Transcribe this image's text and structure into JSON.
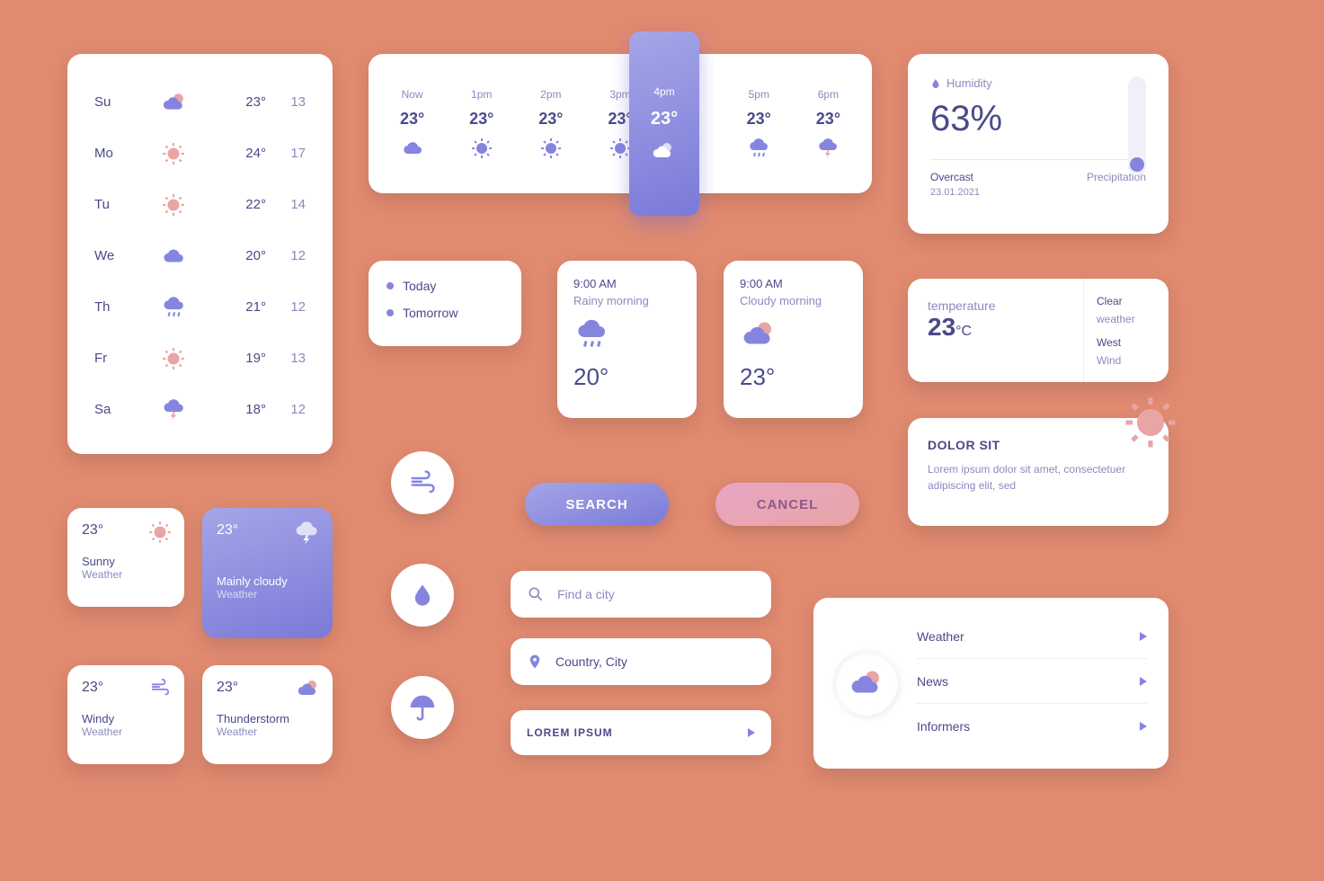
{
  "weekly": [
    {
      "day": "Su",
      "icon": "partly-cloudy",
      "hi": "23°",
      "lo": "13"
    },
    {
      "day": "Mo",
      "icon": "sun-pink",
      "hi": "24°",
      "lo": "17"
    },
    {
      "day": "Tu",
      "icon": "sun-pink",
      "hi": "22°",
      "lo": "14"
    },
    {
      "day": "We",
      "icon": "cloud",
      "hi": "20°",
      "lo": "12"
    },
    {
      "day": "Th",
      "icon": "rain",
      "hi": "21°",
      "lo": "12"
    },
    {
      "day": "Fr",
      "icon": "sun-pink",
      "hi": "19°",
      "lo": "13"
    },
    {
      "day": "Sa",
      "icon": "storm",
      "hi": "18°",
      "lo": "12"
    }
  ],
  "hourly": [
    {
      "time": "Now",
      "temp": "23°",
      "icon": "cloud"
    },
    {
      "time": "1pm",
      "temp": "23°",
      "icon": "sun"
    },
    {
      "time": "2pm",
      "temp": "23°",
      "icon": "sun"
    },
    {
      "time": "3pm",
      "temp": "23°",
      "icon": "sun"
    },
    {
      "time": "4pm",
      "temp": "23°",
      "icon": "partly-cloudy-white",
      "selected": true
    },
    {
      "time": "5pm",
      "temp": "23°",
      "icon": "rain"
    },
    {
      "time": "6pm",
      "temp": "23°",
      "icon": "storm"
    }
  ],
  "humidity": {
    "label": "Humidity",
    "value": "63%",
    "cond": "Overcast",
    "precip": "Precipitation",
    "date": "23.01.2021"
  },
  "legend": {
    "today": "Today",
    "tomorrow": "Tomorrow"
  },
  "morning": [
    {
      "time": "9:00 AM",
      "cond": "Rainy morning",
      "icon": "rain",
      "temp": "20°"
    },
    {
      "time": "9:00 AM",
      "cond": "Cloudy morning",
      "icon": "partly-cloudy",
      "temp": "23°"
    }
  ],
  "tempcard": {
    "label": "temperature",
    "value": "23",
    "unit": "°C",
    "r1": "Clear",
    "r2": "weather",
    "r3": "West",
    "r4": "Wind"
  },
  "dolor": {
    "title": "DOLOR SIT",
    "body": "Lorem ipsum dolor sit amet, consectetuer adipiscing elit, sed"
  },
  "small": [
    {
      "temp": "23°",
      "cond": "Sunny",
      "sub": "Weather",
      "icon": "sun-pink"
    },
    {
      "temp": "23°",
      "cond": "Mainly cloudy",
      "sub": "Weather",
      "icon": "storm-white"
    },
    {
      "temp": "23°",
      "cond": "Windy",
      "sub": "Weather",
      "icon": "wind"
    },
    {
      "temp": "23°",
      "cond": "Thunderstorm",
      "sub": "Weather",
      "icon": "partly-cloudy"
    }
  ],
  "buttons": {
    "search": "SEARCH",
    "cancel": "CANCEL"
  },
  "inputs": {
    "city_placeholder": "Find a city",
    "location": "Country, City",
    "lorem": "LOREM IPSUM"
  },
  "menu": [
    "Weather",
    "News",
    "Informers"
  ]
}
